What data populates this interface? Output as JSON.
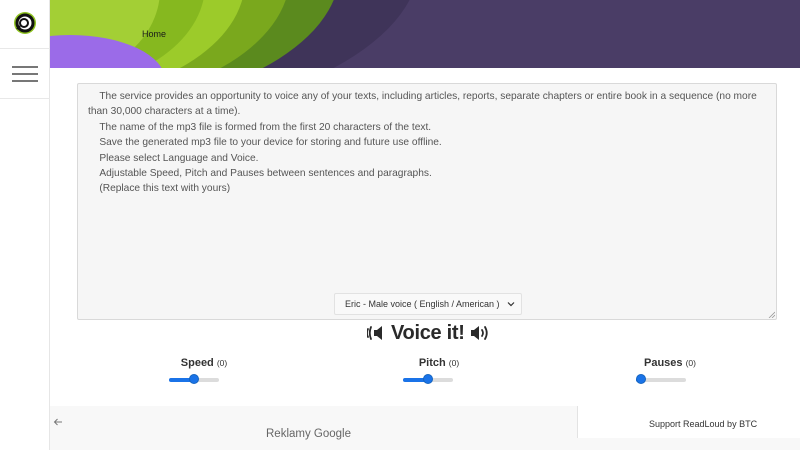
{
  "nav": {
    "home_label": "Home"
  },
  "editor": {
    "text": "    The service provides an opportunity to voice any of your texts, including articles, reports, separate chapters or entire book in a sequence (no more than 30,000 characters at a time).\n    The name of the mp3 file is formed from the first 20 characters of the text.\n    Save the generated mp3 file to your device for storing and future use offline.\n    Please select Language and Voice.\n    Adjustable Speed, Pitch and Pauses between sentences and paragraphs.\n    (Replace this text with yours)",
    "voice_selected": "Eric - Male voice ( English / American )"
  },
  "actions": {
    "voice_it_label": "Voice it!"
  },
  "controls": {
    "speed": {
      "label": "Speed",
      "value_text": "(0)",
      "level": 0.5
    },
    "pitch": {
      "label": "Pitch",
      "value_text": "(0)",
      "level": 0.5
    },
    "pauses": {
      "label": "Pauses",
      "value_text": "(0)",
      "level": 0.0
    }
  },
  "footer": {
    "ads_label": "Reklamy Google",
    "support_label": "Support ReadLoud by BTC"
  },
  "colors": {
    "accent": "#1a73e8",
    "banner_purple": "#4a3d66",
    "banner_green": "#8dc21f",
    "banner_violet": "#9b6be8"
  },
  "icons": {
    "logo": "readloud-logo-icon",
    "menu": "hamburger-icon",
    "speaker_left": "speaker-left-icon",
    "speaker_right": "speaker-right-icon",
    "back": "arrow-left-icon",
    "dropdown": "chevron-down-icon"
  }
}
